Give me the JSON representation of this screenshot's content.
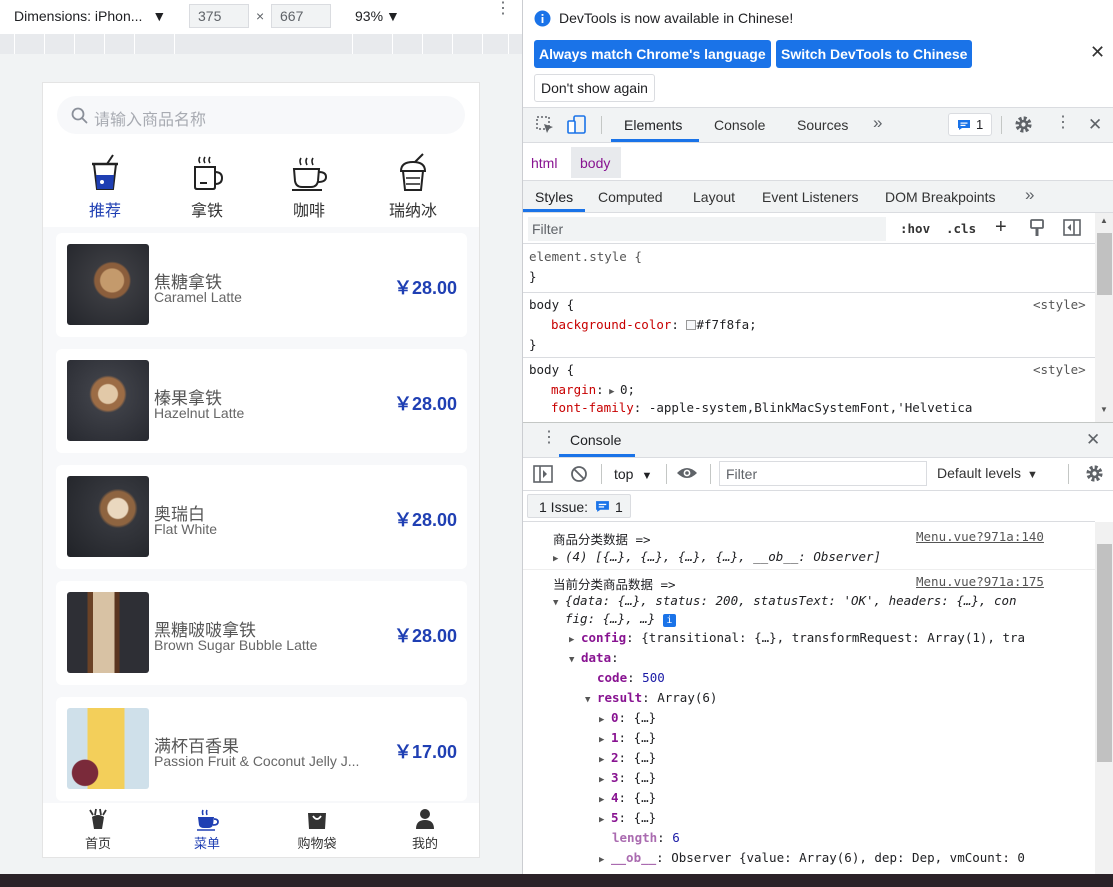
{
  "device_toolbar": {
    "dimensions_label": "Dimensions: iPhon...",
    "width": "375",
    "height": "667",
    "times": "×",
    "zoom": "93%"
  },
  "app": {
    "search_placeholder": "请输入商品名称",
    "categories": [
      {
        "label": "推荐",
        "icon": "recommend-cup-icon",
        "active": true
      },
      {
        "label": "拿铁",
        "icon": "latte-mug-icon",
        "active": false
      },
      {
        "label": "咖啡",
        "icon": "coffee-cup-icon",
        "active": false
      },
      {
        "label": "瑞纳冰",
        "icon": "frappe-icon",
        "active": false
      }
    ],
    "products": [
      {
        "name": "焦糖拿铁",
        "en": "Caramel Latte",
        "price": "￥28.00",
        "image": "caramel-latte-image"
      },
      {
        "name": "榛果拿铁",
        "en": "Hazelnut Latte",
        "price": "￥28.00",
        "image": "hazelnut-latte-image"
      },
      {
        "name": "奥瑞白",
        "en": "Flat White",
        "price": "￥28.00",
        "image": "flat-white-image"
      },
      {
        "name": "黑糖啵啵拿铁",
        "en": "Brown Sugar Bubble Latte",
        "price": "￥28.00",
        "image": "brown-sugar-latte-image"
      },
      {
        "name": "满杯百香果",
        "en": "Passion Fruit & Coconut Jelly J...",
        "price": "￥17.00",
        "image": "passion-fruit-image"
      }
    ],
    "tabs": [
      {
        "label": "首页",
        "icon": "home-deer-icon",
        "active": false
      },
      {
        "label": "菜单",
        "icon": "menu-cup-icon",
        "active": true
      },
      {
        "label": "购物袋",
        "icon": "shopping-bag-icon",
        "active": false
      },
      {
        "label": "我的",
        "icon": "user-icon",
        "active": false
      }
    ],
    "colors": {
      "accent": "#1f3fb3",
      "background": "#f7f8fa"
    }
  },
  "devtools": {
    "banner": {
      "text": "DevTools is now available in Chinese!",
      "match_btn": "Always match Chrome's language",
      "switch_btn": "Switch DevTools to Chinese",
      "dont_show_btn": "Don't show again"
    },
    "main_tabs": [
      "Elements",
      "Console",
      "Sources"
    ],
    "issues_count": "1",
    "breadcrumb": [
      "html",
      "body"
    ],
    "styles_tabs": [
      "Styles",
      "Computed",
      "Layout",
      "Event Listeners",
      "DOM Breakpoints"
    ],
    "filter_placeholder": "Filter",
    "hov": ":hov",
    "cls": ".cls",
    "rules": {
      "element_style": "element.style {",
      "close": "}",
      "body1_sel": "body {",
      "body1_src": "<style>",
      "body1_prop": "background-color",
      "body1_val": "#f7f8fa;",
      "body2_sel": "body {",
      "body2_src": "<style>",
      "body2_prop1": "margin",
      "body2_val1": "0;",
      "body2_prop2": "font-family",
      "body2_val2": "-apple-system,BlinkMacSystemFont,'Helvetica"
    },
    "console": {
      "title": "Console",
      "context": "top",
      "filter_placeholder": "Filter",
      "levels": "Default levels",
      "issue_label": "1 Issue:",
      "issue_count": "1",
      "log1_label": "商品分类数据 =>",
      "log1_src": "Menu.vue?971a:140",
      "log1_value": "(4) [{…}, {…}, {…}, {…}, __ob__: Observer]",
      "log2_label": "当前分类商品数据 =>",
      "log2_src": "Menu.vue?971a:175",
      "log2_value_a": "{data: {…}, status: 200, statusText: 'OK', headers: {…}, con",
      "log2_value_b": "fig: {…}, …}",
      "config_key": "config",
      "config_val": "{transitional: {…}, transformRequest: Array(1), tra",
      "data_key": "data",
      "code_key": "code",
      "code_val": "500",
      "result_key": "result",
      "result_val": "Array(6)",
      "result_items": [
        "0",
        "1",
        "2",
        "3",
        "4",
        "5"
      ],
      "item_val": "{…}",
      "length_key": "length",
      "length_val": "6",
      "ob_key": "__ob__",
      "ob_val": "Observer {value: Array(6), dep: Dep, vmCount: 0"
    }
  }
}
